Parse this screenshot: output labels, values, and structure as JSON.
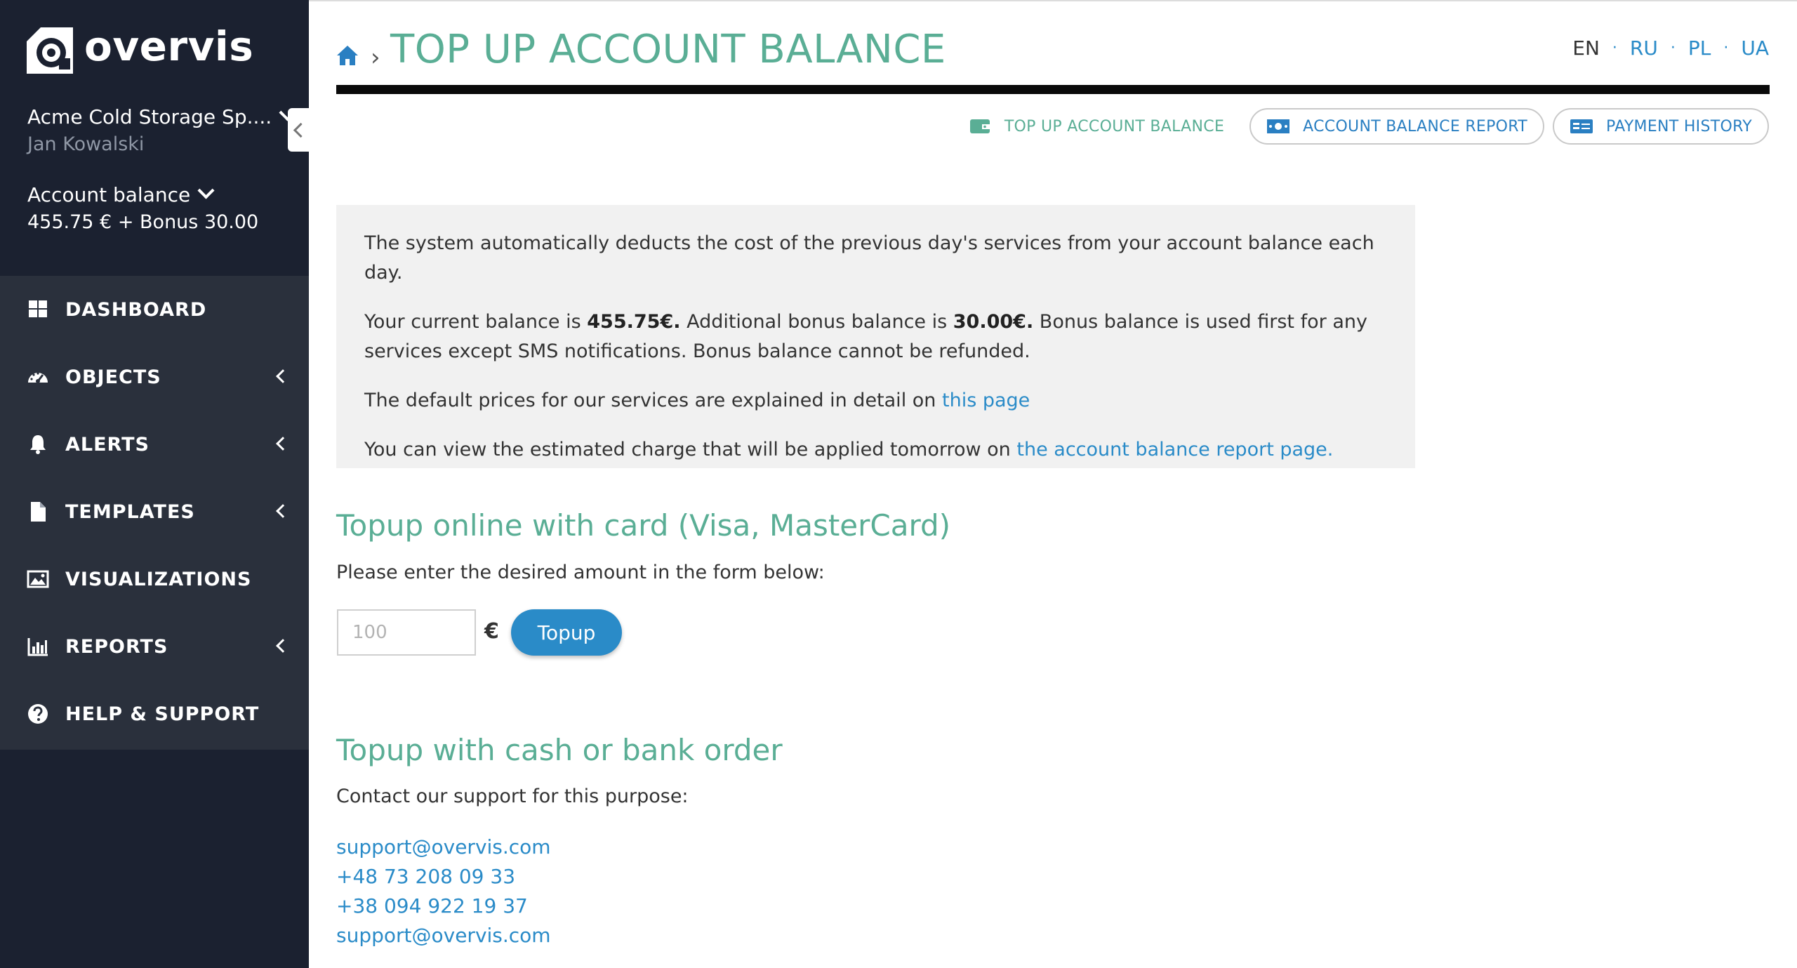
{
  "brand": {
    "name": "overvis"
  },
  "account": {
    "company": "Acme Cold Storage Sp....",
    "user": "Jan Kowalski",
    "balance_label": "Account balance",
    "balance_value": "455.75 € + Bonus 30.00"
  },
  "nav": {
    "items": [
      {
        "label": "DASHBOARD",
        "icon": "grid-icon",
        "has_submenu": false
      },
      {
        "label": "OBJECTS",
        "icon": "speedometer-icon",
        "has_submenu": true
      },
      {
        "label": "ALERTS",
        "icon": "bell-icon",
        "has_submenu": true
      },
      {
        "label": "TEMPLATES",
        "icon": "document-icon",
        "has_submenu": true
      },
      {
        "label": "VISUALIZATIONS",
        "icon": "image-icon",
        "has_submenu": false
      },
      {
        "label": "REPORTS",
        "icon": "bar-chart-icon",
        "has_submenu": true
      },
      {
        "label": "HELP & SUPPORT",
        "icon": "question-circle-icon",
        "has_submenu": false
      }
    ]
  },
  "header": {
    "breadcrumb_separator": "›",
    "title": "TOP UP ACCOUNT BALANCE"
  },
  "languages": [
    {
      "code": "EN",
      "active": true
    },
    {
      "code": "RU",
      "active": false
    },
    {
      "code": "PL",
      "active": false
    },
    {
      "code": "UA",
      "active": false
    }
  ],
  "language_separator": "·",
  "subnav": {
    "topup": "TOP UP ACCOUNT BALANCE",
    "report": "ACCOUNT BALANCE REPORT",
    "history": "PAYMENT HISTORY"
  },
  "info": {
    "line1": "The system automatically deducts the cost of the previous day's services from your account balance each day.",
    "balance_prefix": "Your current balance is ",
    "balance_amount": "455.75€.",
    "bonus_prefix": " Additional bonus balance is ",
    "bonus_amount": "30.00€.",
    "bonus_suffix": " Bonus balance is used first for any services except SMS notifications. Bonus balance cannot be refunded.",
    "prices_prefix": "The default prices for our services are explained in detail on ",
    "prices_link": "this page",
    "estimate_prefix": "You can view the estimated charge that will be applied tomorrow on ",
    "estimate_link": "the account balance report page."
  },
  "card_section": {
    "title": "Topup online with card (Visa, MasterCard)",
    "instruction": "Please enter the desired amount in the form below:",
    "amount_placeholder": "100",
    "currency": "€",
    "button": "Topup"
  },
  "cash_section": {
    "title": "Topup with cash or bank order",
    "instruction": "Contact our support for this purpose:",
    "contacts": [
      "support@overvis.com",
      "+48 73 208 09 33",
      "+38 094 922 19 37",
      "support@overvis.com"
    ]
  },
  "colors": {
    "sidebar_bg": "#1b2130",
    "nav_bg": "#2a303c",
    "accent_green": "#5aae95",
    "link_blue": "#2a8bc8",
    "info_bg": "#f1f1f1"
  }
}
